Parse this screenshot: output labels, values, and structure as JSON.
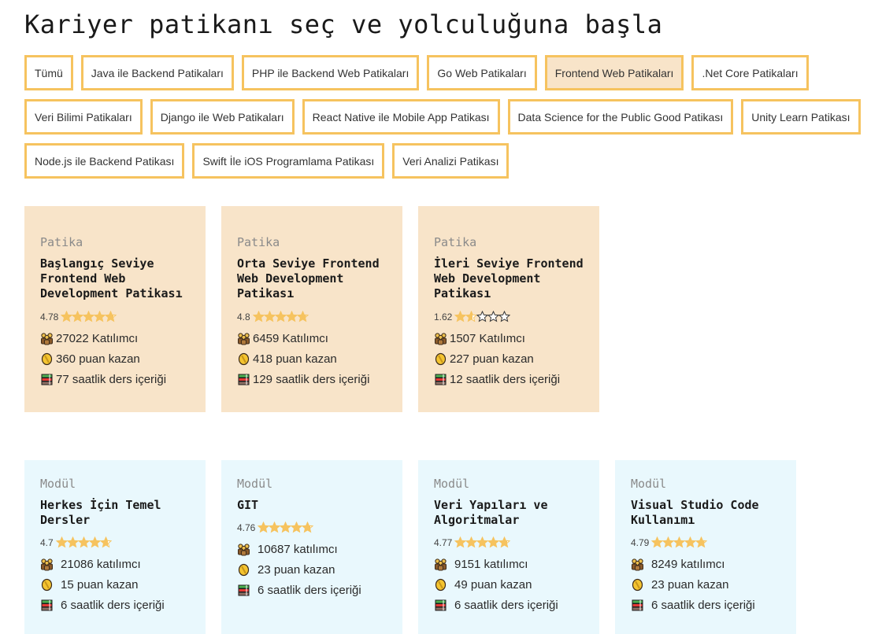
{
  "page": {
    "title": "Kariyer patikanı seç ve yolculuğuna başla"
  },
  "filters": {
    "rows": [
      [
        {
          "label": "Tümü",
          "active": false
        },
        {
          "label": "Java ile Backend Patikaları",
          "active": false
        },
        {
          "label": "PHP ile Backend Web Patikaları",
          "active": false
        },
        {
          "label": "Go Web Patikaları",
          "active": false
        },
        {
          "label": "Frontend Web Patikaları",
          "active": true
        },
        {
          "label": ".Net Core Patikaları",
          "active": false
        }
      ],
      [
        {
          "label": "Veri Bilimi Patikaları",
          "active": false
        },
        {
          "label": "Django ile Web Patikaları",
          "active": false
        },
        {
          "label": "React Native ile Mobile App Patikası",
          "active": false
        },
        {
          "label": "Data Science for the Public Good Patikası",
          "active": false
        },
        {
          "label": "Unity Learn Patikası",
          "active": false
        }
      ],
      [
        {
          "label": "Node.js ile Backend Patikası",
          "active": false
        },
        {
          "label": "Swift İle iOS Programlama Patikası",
          "active": false
        },
        {
          "label": "Veri Analizi Patikası",
          "active": false
        }
      ]
    ]
  },
  "colors": {
    "accent_border": "#f6c35f",
    "path_card_bg": "#f8e4c9",
    "module_card_bg": "#e9f8fd",
    "star_fill": "#f6c35f"
  },
  "icons": {
    "participants": "people-icon",
    "points": "coin-icon",
    "hours": "books-icon",
    "rating": "star-icon"
  },
  "paths": [
    {
      "kind": "Patika",
      "title": "Başlangıç Seviye Frontend Web Development Patikası",
      "rating": "4.78",
      "rating_value": 4.78,
      "participants": "27022 Katılımcı",
      "points": "360 puan kazan",
      "hours": "77 saatlik ders içeriği"
    },
    {
      "kind": "Patika",
      "title": "Orta Seviye Frontend Web Development Patikası",
      "rating": "4.8",
      "rating_value": 4.8,
      "participants": "6459 Katılımcı",
      "points": "418 puan kazan",
      "hours": "129 saatlik ders içeriği"
    },
    {
      "kind": "Patika",
      "title": "İleri Seviye Frontend Web Development Patikası",
      "rating": "1.62",
      "rating_value": 1.62,
      "participants": "1507 Katılımcı",
      "points": "227 puan kazan",
      "hours": "12 saatlik ders içeriği"
    }
  ],
  "modules": [
    {
      "kind": "Modül",
      "title": "Herkes İçin Temel Dersler",
      "rating": "4.7",
      "rating_value": 4.7,
      "participants": "21086 katılımcı",
      "points": "15 puan kazan",
      "hours": "6 saatlik ders içeriği"
    },
    {
      "kind": "Modül",
      "title": "GIT",
      "rating": "4.76",
      "rating_value": 4.76,
      "participants": "10687 katılımcı",
      "points": "23 puan kazan",
      "hours": "6 saatlik ders içeriği"
    },
    {
      "kind": "Modül",
      "title": "Veri Yapıları ve Algoritmalar",
      "rating": "4.77",
      "rating_value": 4.77,
      "participants": "9151 katılımcı",
      "points": "49 puan kazan",
      "hours": "6 saatlik ders içeriği"
    },
    {
      "kind": "Modül",
      "title": "Visual Studio Code Kullanımı",
      "rating": "4.79",
      "rating_value": 4.79,
      "participants": "8249 katılımcı",
      "points": "23 puan kazan",
      "hours": "6 saatlik ders içeriği"
    }
  ]
}
